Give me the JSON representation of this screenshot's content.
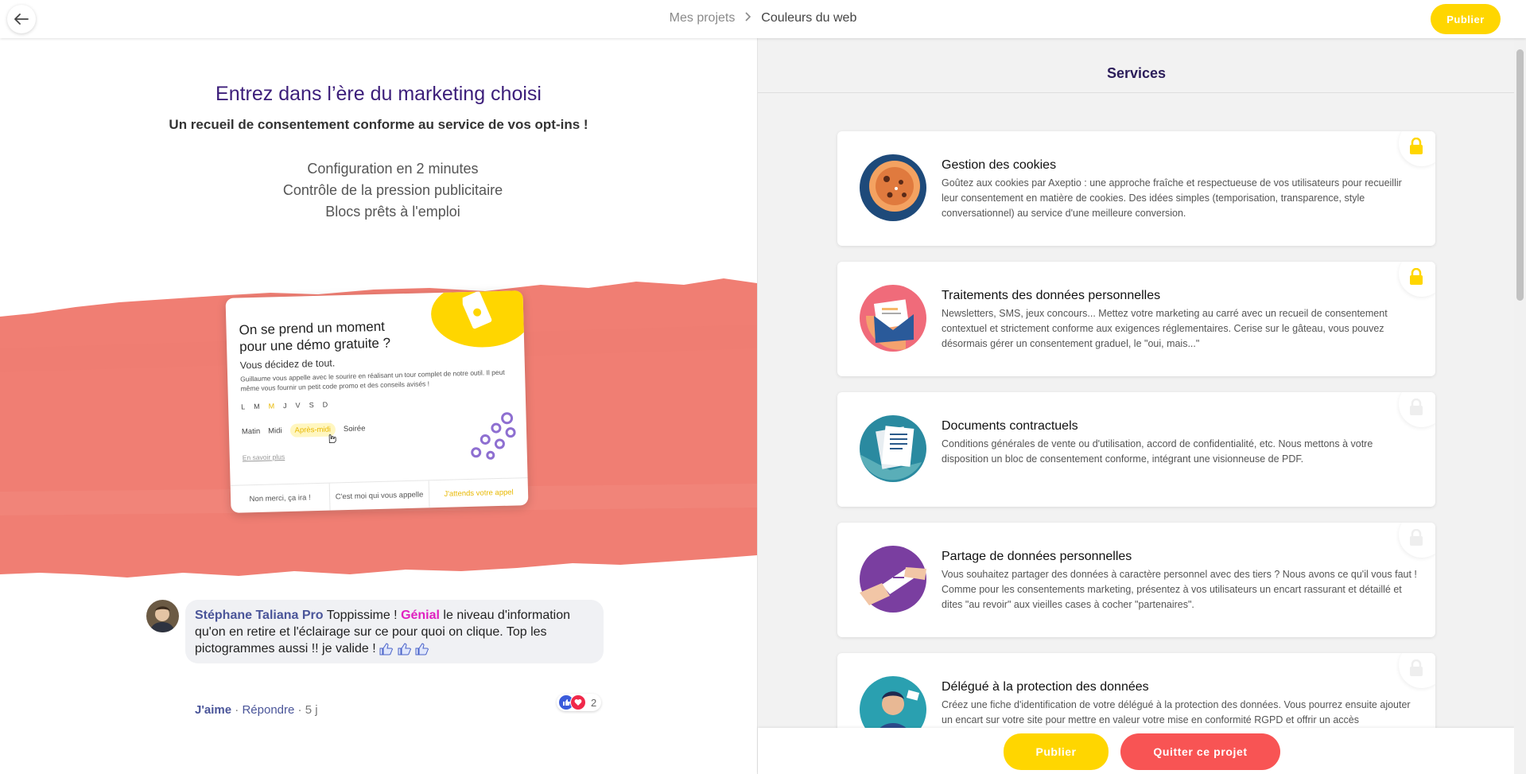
{
  "header": {
    "breadcrumb_parent": "Mes projets",
    "breadcrumb_current": "Couleurs du web",
    "publish_label": "Publier"
  },
  "hero": {
    "title": "Entrez dans l’ère du marketing choisi",
    "subtitle": "Un recueil de consentement conforme au service de vos opt-ins !",
    "features": [
      "Configuration en 2 minutes",
      "Contrôle de la pression publicitaire",
      "Blocs prêts à l'emploi"
    ]
  },
  "demo": {
    "title": "On se prend un moment pour une démo gratuite ?",
    "subtitle": "Vous décidez de tout.",
    "text": "Guillaume vous appelle avec le sourire en réalisant un tour complet de notre outil. Il peut même vous fournir un petit code promo et des conseils avisés !",
    "days": [
      "L",
      "M",
      "M",
      "J",
      "V",
      "S",
      "D"
    ],
    "slots": [
      "Matin",
      "Midi",
      "Après-midi",
      "Soirée"
    ],
    "link": "En savoir plus",
    "buttons": [
      "Non merci, ça ira !",
      "C'est moi qui vous appelle",
      "J'attends votre appel"
    ]
  },
  "comment": {
    "author": "Stéphane Taliana Pro",
    "part1": "Toppissime !",
    "highlight": "Génial",
    "part2": "le niveau d'information qu'on en retire et l'éclairage sur ce pour quoi on clique. Top les pictogrammes aussi !! je valide !",
    "reaction_count": "2",
    "like_label": "J'aime",
    "reply_label": "Répondre",
    "time": "5 j",
    "separator": "·"
  },
  "services": {
    "title": "Services",
    "items": [
      {
        "title": "Gestion des cookies",
        "desc": "Goûtez aux cookies par Axeptio : une approche fraîche et respectueuse de vos utilisateurs pour recueillir leur consentement en matière de cookies. Des idées simples (temporisation, transparence, style conversationnel) au service d'une meilleure conversion.",
        "icon": "cookie-icon",
        "locked": true
      },
      {
        "title": "Traitements des données personnelles",
        "desc": "Newsletters, SMS, jeux concours... Mettez votre marketing au carré avec un recueil de consentement contextuel et strictement conforme aux exigences réglementaires. Cerise sur le gâteau, vous pouvez désormais gérer un consentement graduel, le \"oui, mais...\"",
        "icon": "envelope-icon",
        "locked": true
      },
      {
        "title": "Documents contractuels",
        "desc": "Conditions générales de vente ou d'utilisation, accord de confidentialité, etc. Nous mettons à votre disposition un bloc de consentement conforme, intégrant une visionneuse de PDF.",
        "icon": "documents-icon",
        "locked": false
      },
      {
        "title": "Partage de données personnelles",
        "desc": "Vous souhaitez partager des données à caractère personnel avec des tiers ? Nous avons ce qu'il vous faut ! Comme pour les consentements marketing, présentez à vos utilisateurs un encart rassurant et détaillé et dites \"au revoir\" aux vieilles cases à cocher \"partenaires\".",
        "icon": "handshake-icon",
        "locked": false
      },
      {
        "title": "Délégué à la protection des données",
        "desc": "Créez une fiche d'identification de votre délégué à la protection des données. Vous pourrez ensuite ajouter un encart sur votre site pour mettre en valeur votre mise en conformité RGPD et offrir un accès",
        "icon": "dpo-icon",
        "locked": false
      }
    ]
  },
  "footer": {
    "publish_label": "Publier",
    "quit_label": "Quitter ce projet"
  },
  "colors": {
    "accent_yellow": "#ffd600",
    "danger_red": "#f85454",
    "title_purple": "#3c1e7a",
    "brush_salmon": "#f07e73"
  }
}
